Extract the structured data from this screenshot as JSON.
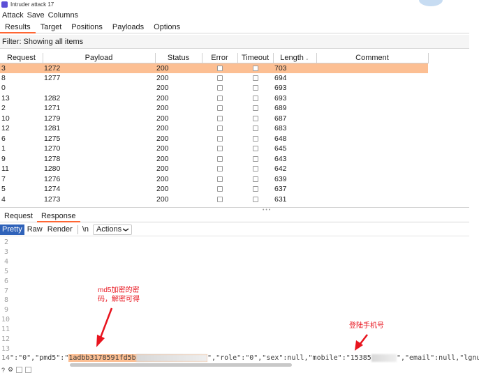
{
  "window": {
    "title": "Intruder attack 17"
  },
  "menu": [
    "Attack",
    "Save",
    "Columns"
  ],
  "tabs": [
    {
      "label": "Results",
      "active": true
    },
    {
      "label": "Target",
      "active": false
    },
    {
      "label": "Positions",
      "active": false
    },
    {
      "label": "Payloads",
      "active": false
    },
    {
      "label": "Options",
      "active": false
    }
  ],
  "filter": {
    "text": "Filter: Showing all items"
  },
  "table": {
    "columns": [
      "Request",
      "Payload",
      "Status",
      "Error",
      "Timeout",
      "Length",
      "Comment"
    ],
    "sort_column": "Length",
    "rows": [
      {
        "request": "3",
        "payload": "1272",
        "status": "200",
        "length": "703",
        "selected": true
      },
      {
        "request": "8",
        "payload": "1277",
        "status": "200",
        "length": "694"
      },
      {
        "request": "0",
        "payload": "",
        "status": "200",
        "length": "693"
      },
      {
        "request": "13",
        "payload": "1282",
        "status": "200",
        "length": "693"
      },
      {
        "request": "2",
        "payload": "1271",
        "status": "200",
        "length": "689"
      },
      {
        "request": "10",
        "payload": "1279",
        "status": "200",
        "length": "687"
      },
      {
        "request": "12",
        "payload": "1281",
        "status": "200",
        "length": "683"
      },
      {
        "request": "6",
        "payload": "1275",
        "status": "200",
        "length": "648"
      },
      {
        "request": "1",
        "payload": "1270",
        "status": "200",
        "length": "645"
      },
      {
        "request": "9",
        "payload": "1278",
        "status": "200",
        "length": "643"
      },
      {
        "request": "11",
        "payload": "1280",
        "status": "200",
        "length": "642"
      },
      {
        "request": "7",
        "payload": "1276",
        "status": "200",
        "length": "639"
      },
      {
        "request": "5",
        "payload": "1274",
        "status": "200",
        "length": "637"
      },
      {
        "request": "4",
        "payload": "1273",
        "status": "200",
        "length": "631"
      }
    ]
  },
  "rr_tabs": [
    {
      "label": "Request",
      "active": false
    },
    {
      "label": "Response",
      "active": true
    }
  ],
  "view_buttons": [
    {
      "label": "Pretty",
      "active": true
    },
    {
      "label": "Raw",
      "active": false
    },
    {
      "label": "Render",
      "active": false
    },
    {
      "label": "\\n",
      "active": false
    }
  ],
  "actions_label": "Actions",
  "editor": {
    "line_numbers": [
      "2",
      "3",
      "4",
      "5",
      "6",
      "7",
      "8",
      "9",
      "10",
      "11",
      "12",
      "13",
      "14"
    ],
    "code_prefix": "\":\"0\",\"pmd5\":\"",
    "md5_visible": "1adbb3178591fd5b",
    "md5_hidden": "xxxxxxxxxx3190303",
    "code_middle": "\",\"role\":\"0\",\"sex\":null,\"mobile\":\"15385",
    "mobile_hidden": "xxxxxx",
    "code_suffix": "\",\"email\":null,\"lgnums\""
  },
  "annotations": {
    "md5_note": "md5加密的密\n码，解密可得",
    "mobile_note": "登陆手机号"
  },
  "colors": {
    "accent": "#ff6633",
    "selected_row": "#fcbf93",
    "annotation": "#e8141e",
    "active_view": "#2f62b9"
  }
}
